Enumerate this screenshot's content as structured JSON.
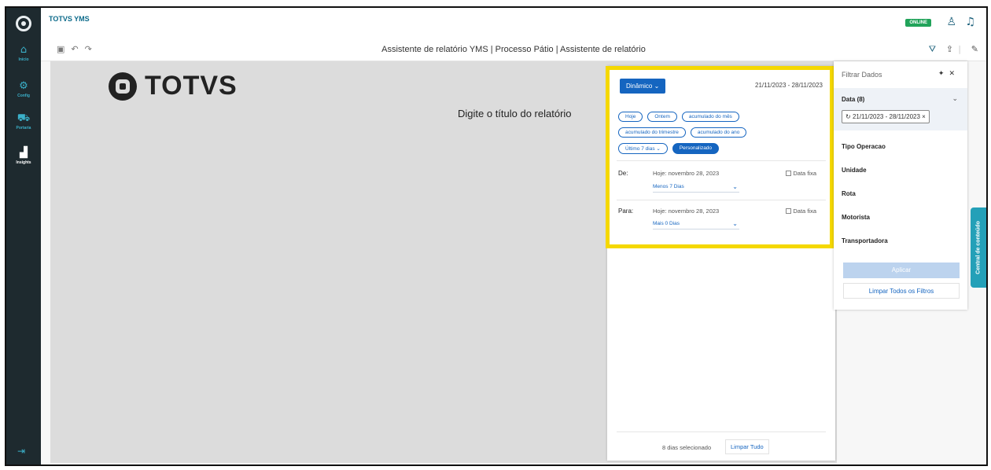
{
  "app": {
    "title": "TOTVS YMS",
    "status": "ONLINE"
  },
  "sidebar": {
    "items": [
      {
        "label": "Início",
        "icon": "home-icon"
      },
      {
        "label": "Config",
        "icon": "gear-icon"
      },
      {
        "label": "Portaria",
        "icon": "truck-icon"
      },
      {
        "label": "Insights",
        "icon": "chart-icon"
      }
    ]
  },
  "toolbar": {
    "report_title": "Assistente de relatório YMS | Processo Pátio | Assistente de relatório"
  },
  "canvas": {
    "logo_text": "TOTVS",
    "title_placeholder": "Digite o título do relatório"
  },
  "date_panel": {
    "mode": "Dinâmico",
    "range": "21/11/2023 - 28/11/2023",
    "chips_row1": [
      "Hoje",
      "Ontem",
      "acumulado do mês"
    ],
    "chips_row2": [
      "acumulado do trimestre",
      "acumulado do ano"
    ],
    "chips_row3": [
      "Último 7 dias",
      "Personalizado"
    ],
    "from": {
      "label": "De:",
      "date": "Hoje: novembro 28, 2023",
      "fixed": "Data fixa",
      "offset": "Menos 7 Dias"
    },
    "to": {
      "label": "Para:",
      "date": "Hoje: novembro 28, 2023",
      "fixed": "Data fixa",
      "offset": "Mais 0 Dias"
    },
    "footer": "8 dias selecionado",
    "clear_all": "Limpar Tudo"
  },
  "filter_panel": {
    "title": "Filtrar Dados",
    "data_label": "Data (8)",
    "data_chip": "21/11/2023 - 28/11/2023",
    "items": [
      "Tipo Operacao",
      "Unidade",
      "Rota",
      "Motorista",
      "Transportadora"
    ],
    "apply": "Aplicar",
    "clear_filters": "Limpar Todos os Filtros"
  },
  "side_tab": {
    "label": "Central de conteúdo"
  },
  "colors": {
    "accent": "#1565c0",
    "highlight": "#f5d800",
    "sidebar": "#1e2a2f",
    "online": "#21a35a"
  }
}
